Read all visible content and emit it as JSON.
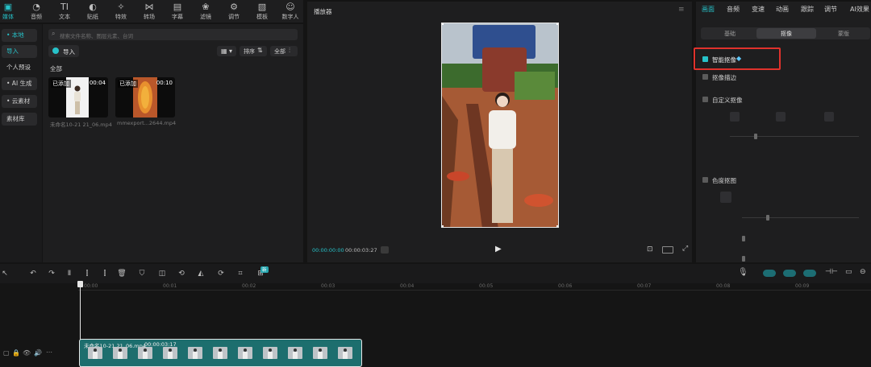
{
  "toolbar": {
    "items": [
      {
        "icon": "media-icon",
        "label": "媒体"
      },
      {
        "icon": "audio-icon",
        "label": "音频"
      },
      {
        "icon": "text-icon",
        "label": "文本"
      },
      {
        "icon": "sticker-icon",
        "label": "贴纸"
      },
      {
        "icon": "effects-icon",
        "label": "特效"
      },
      {
        "icon": "transition-icon",
        "label": "转场"
      },
      {
        "icon": "caption-icon",
        "label": "字幕"
      },
      {
        "icon": "filter-icon",
        "label": "滤镜"
      },
      {
        "icon": "adjust-icon",
        "label": "调节"
      },
      {
        "icon": "template-icon",
        "label": "模板"
      },
      {
        "icon": "digital-human-icon",
        "label": "数字人"
      }
    ]
  },
  "left_nav": {
    "items": [
      "• 本地",
      "导入",
      "个人预设",
      "• AI 生成",
      "• 云素材",
      "素材库"
    ]
  },
  "media_panel": {
    "search_placeholder": "搜索文件名称、图层元素、台词",
    "import_label": "导入",
    "sort_label": "排序",
    "filter_label": "全部",
    "section_label": "全部",
    "items": [
      {
        "badge": "已添加",
        "duration": "00:04",
        "name": "未命名10-21 21_06.mp4"
      },
      {
        "badge": "已添加",
        "duration": "00:10",
        "name": "mmexport...2644.mp4"
      }
    ]
  },
  "player": {
    "title": "播放器",
    "current_time": "00:00:00:00",
    "total_time": "00:00:03:27"
  },
  "right_panel": {
    "tabs": [
      "画面",
      "音频",
      "变速",
      "动画",
      "跟踪",
      "调节",
      "AI效果"
    ],
    "subtabs": [
      "基础",
      "抠像",
      "蒙版"
    ],
    "options": {
      "smart_matting": "智能抠像",
      "matting_stroke": "抠像描边",
      "custom_matting": "自定义抠像",
      "chroma_key": "色度抠图"
    }
  },
  "timeline": {
    "new_badge": "新",
    "ticks": [
      "00:00",
      "00:01",
      "00:02",
      "00:03",
      "00:04",
      "00:05",
      "00:06",
      "00:07",
      "00:08",
      "00:09"
    ],
    "clip_label": "未命名10-21 21_06.mp4",
    "clip_duration": "00:00:03:17"
  },
  "colors": {
    "accent": "#27c2c9",
    "highlight": "#e0322c",
    "clip": "#1d6e6e"
  }
}
